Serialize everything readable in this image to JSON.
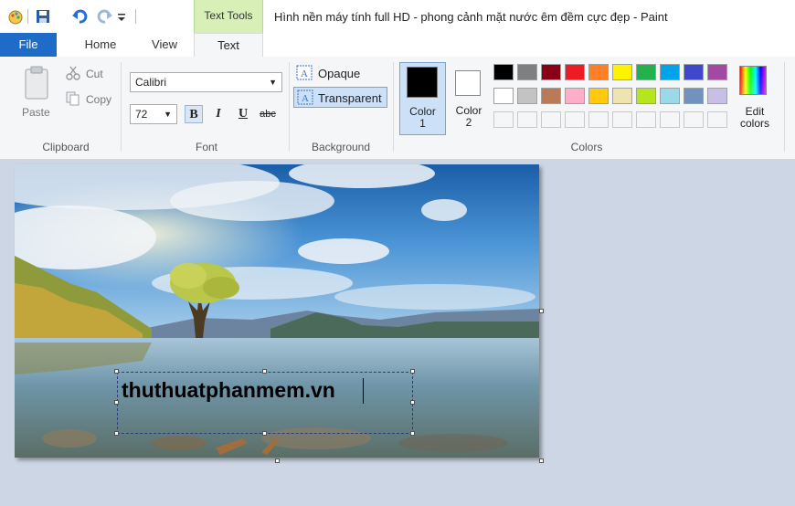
{
  "window": {
    "title": "Hình nền máy tính full HD - phong cảnh mặt nước êm đềm cực đẹp - Paint"
  },
  "contextual_tab": {
    "label": "Text Tools"
  },
  "tabs": {
    "file": "File",
    "home": "Home",
    "view": "View",
    "text": "Text"
  },
  "clipboard": {
    "paste": "Paste",
    "cut": "Cut",
    "copy": "Copy",
    "group_label": "Clipboard"
  },
  "font": {
    "family": "Calibri",
    "size": "72",
    "bold": "B",
    "italic": "I",
    "underline": "U",
    "strike": "abc",
    "group_label": "Font"
  },
  "background": {
    "opaque": "Opaque",
    "transparent": "Transparent",
    "group_label": "Background"
  },
  "colors": {
    "color1_label": "Color",
    "color1_num": "1",
    "color2_label": "Color",
    "color2_num": "2",
    "color1_value": "#000000",
    "color2_value": "#ffffff",
    "edit_label": "Edit",
    "edit_label2": "colors",
    "group_label": "Colors",
    "palette_row1": [
      "#000000",
      "#7f7f7f",
      "#880015",
      "#ed1c24",
      "#ff7f27",
      "#fff200",
      "#22b14c",
      "#00a2e8",
      "#3f48cc",
      "#a349a4"
    ],
    "palette_row2": [
      "#ffffff",
      "#c3c3c3",
      "#b97a57",
      "#ffaec9",
      "#ffc90e",
      "#efe4b0",
      "#b5e61d",
      "#99d9ea",
      "#7092be",
      "#c8bfe7"
    ]
  },
  "canvas": {
    "text": "thuthuatphanmem.vn"
  }
}
